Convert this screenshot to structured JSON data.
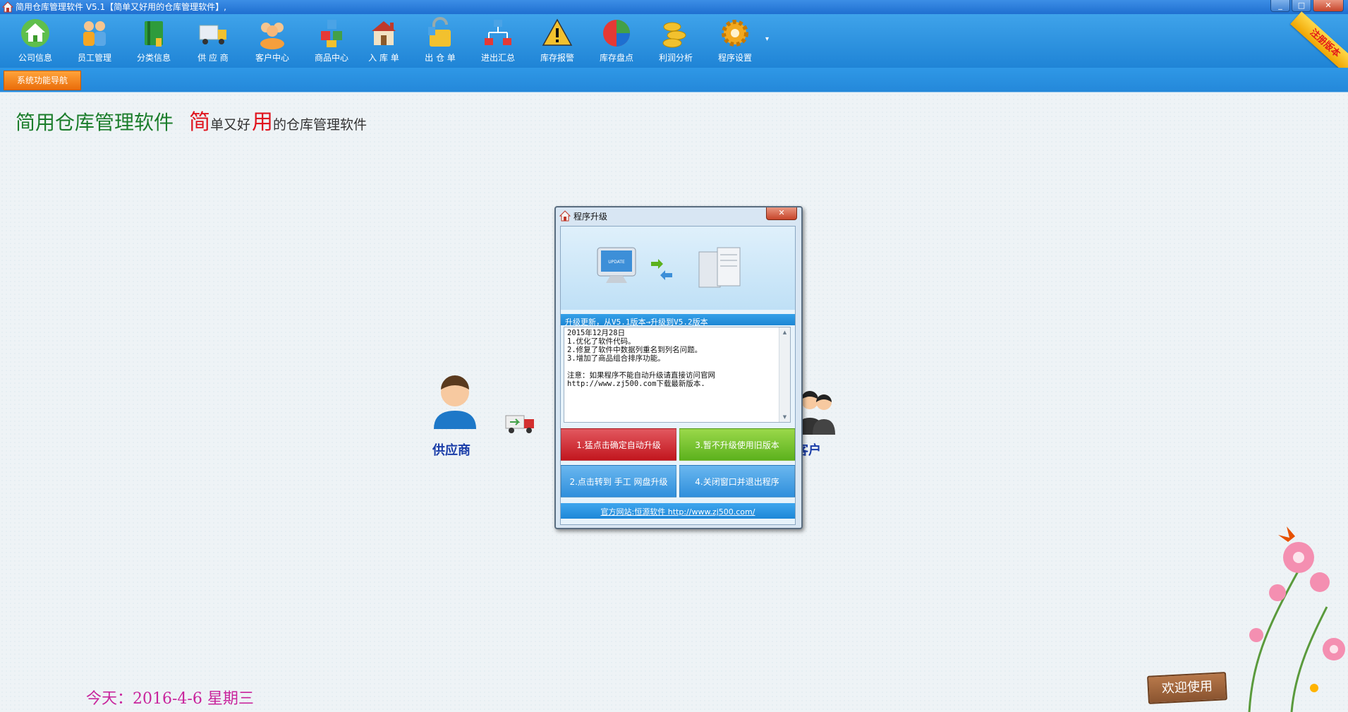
{
  "window": {
    "title": "简用仓库管理软件 V5.1【简单又好用的仓库管理软件】,",
    "controls": [
      "_",
      "□",
      "✕"
    ]
  },
  "toolbar": {
    "items": [
      {
        "label": "公司信息",
        "icon": "company-icon"
      },
      {
        "label": "员工管理",
        "icon": "staff-icon"
      },
      {
        "label": "分类信息",
        "icon": "category-book-icon"
      },
      {
        "label": "供 应 商",
        "icon": "supplier-truck-icon"
      },
      {
        "label": "客户中心",
        "icon": "customers-icon"
      },
      {
        "label": "商品中心",
        "icon": "products-cubes-icon"
      },
      {
        "label": "入 库 单",
        "icon": "stock-in-icon"
      },
      {
        "label": "出 仓 单",
        "icon": "stock-out-icon"
      },
      {
        "label": "进出汇总",
        "icon": "summary-icon"
      },
      {
        "label": "库存报警",
        "icon": "warning-icon"
      },
      {
        "label": "库存盘点",
        "icon": "inventory-pie-icon"
      },
      {
        "label": "利润分析",
        "icon": "coins-icon"
      },
      {
        "label": "程序设置",
        "icon": "settings-gear-icon"
      }
    ],
    "more": "▾",
    "registration_ribbon": "注册版本"
  },
  "nav": {
    "tab_label": "系统功能导航"
  },
  "headline": {
    "main": "简用仓库管理软件",
    "char1": "简",
    "part1": "单又好",
    "char2": "用",
    "part2": "的仓库管理软件"
  },
  "flow": {
    "supplier_label": "供应商",
    "customer_label": "客户"
  },
  "date_line": "今天：2016-4-6 星期三",
  "welcome": "欢迎使用",
  "dialog": {
    "title": "程序升级",
    "close": "✕",
    "section": "升级更新，从V5.1版本→升级到V5.2版本",
    "notes": [
      "2015年12月28日",
      "1.优化了软件代码。",
      "2.修复了软件中数据列重名到列名问题。",
      "3.增加了商品组合排序功能。",
      "",
      "注意：如果程序不能自动升级请直接访问官网",
      "http://www.zj500.com下载最新版本."
    ],
    "btn_auto": "1.猛点击确定自动升级",
    "btn_keep": "3.暂不升级使用旧版本",
    "btn_manual": "2.点击转到 手工 网盘升级",
    "btn_exit": "4.关闭窗口并退出程序",
    "footer_link": "官方网站:恒源软件 http://www.zj500.com/"
  },
  "colors": {
    "toolbar": "#2a8fe0",
    "nav_tab": "#f08a1c",
    "headline_main": "#1b7d2b",
    "headline_accent": "#e0141e",
    "date": "#c8249c",
    "btn_red": "#d0222a",
    "btn_green": "#6cbf2a",
    "btn_blue": "#3a9ae2"
  }
}
